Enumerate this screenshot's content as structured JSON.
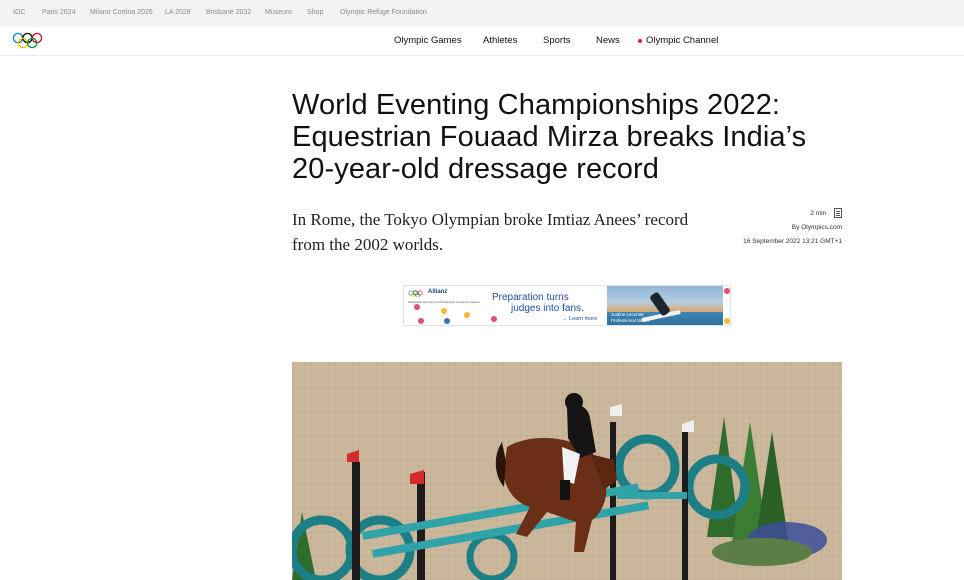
{
  "topbar": {
    "links": [
      "IOC",
      "Paris 2024",
      "Milano Cortina 2026",
      "LA 2028",
      "Brisbane 2032",
      "Museum",
      "Shop",
      "Olympic Refuge Foundation"
    ]
  },
  "nav": {
    "links": [
      "Olympic Games",
      "Athletes",
      "Sports",
      "News",
      "Olympic Channel"
    ],
    "live_color": "#e41c23"
  },
  "article": {
    "title": "World Eventing Championships 2022: Equestrian Fouaad Mirza breaks India’s 20-year-old dressage record",
    "lead": "In Rome, the Tokyo Olympian broke Imtiaz Anees’ record from the 2002 worlds.",
    "read_time": "2 min",
    "read_icon": "article-icon",
    "author": "By Olympics.com",
    "published": "16 September 2022 13:21 GMT+1"
  },
  "ad": {
    "brand": "Allianz",
    "sub": "Worldwide Olympic and Paralympic Insurance Partner",
    "headline_1": "Preparation turns",
    "headline_2": "judges into fans.",
    "cta": "→ Learn more",
    "caption_1": "Justine Lecomte",
    "caption_2": "Professional Surfer"
  },
  "hero": {
    "description_icon": "equestrian-photo"
  },
  "colors": {
    "accent_blue": "#1e4fa0",
    "ring_blue": "#0085c7",
    "ring_yellow": "#f4c300",
    "ring_black": "#000000",
    "ring_green": "#009f3d",
    "ring_red": "#df0024"
  }
}
